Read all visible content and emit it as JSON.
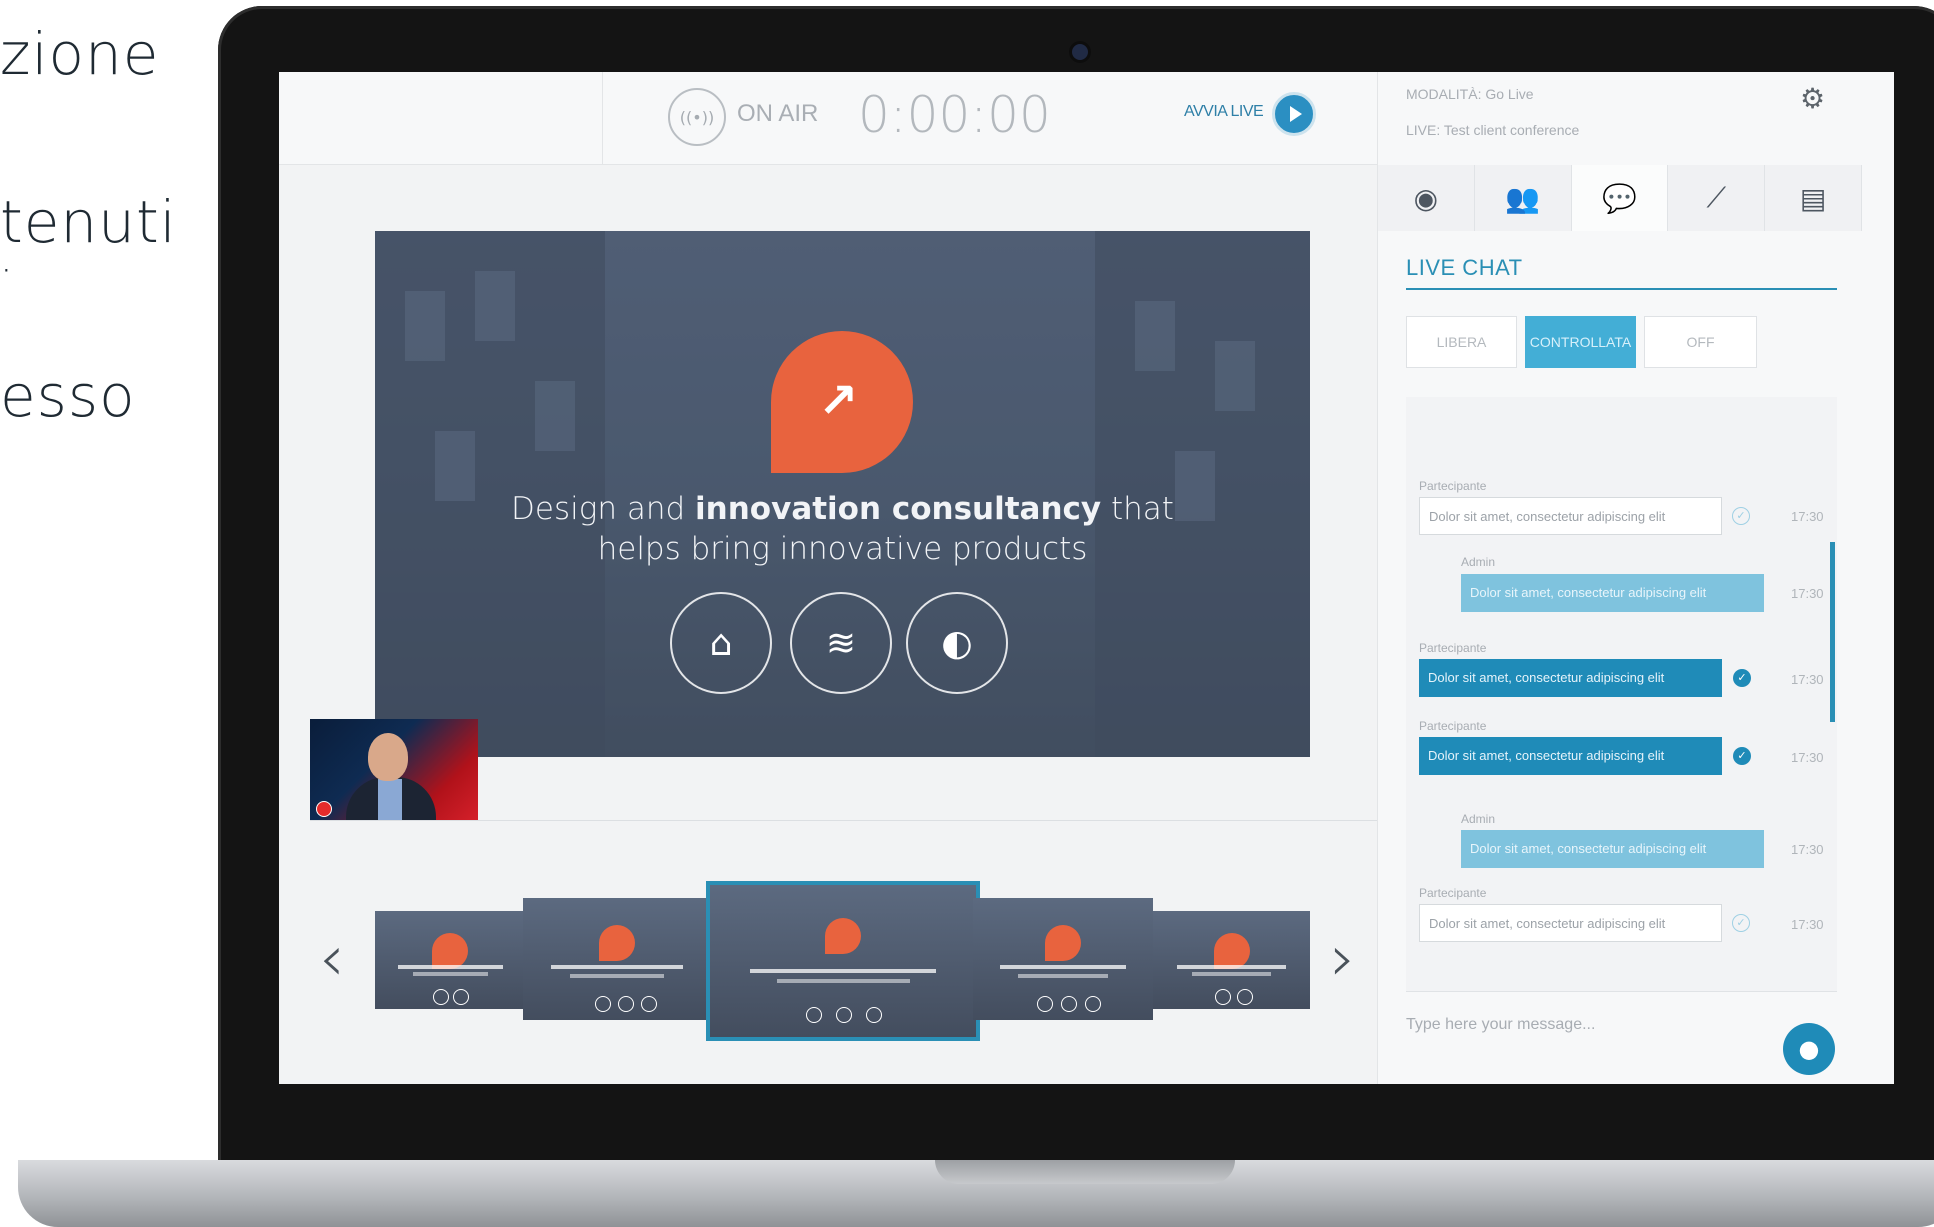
{
  "side_texts": [
    "zione",
    "tenuti",
    "esso"
  ],
  "topbar": {
    "onair_icon": "((•))",
    "onair_label": "ON AIR",
    "timer": "0:00:00",
    "start_label": "AVVIA LIVE"
  },
  "slide": {
    "title_pre": "Design and ",
    "title_bold": "innovation consultancy",
    "title_post": " that",
    "title_line2": "helps bring innovative products",
    "badge_icon": "chart-growth-icon",
    "buttons": [
      "tag-icon",
      "wifi-icon",
      "contrast-icon"
    ]
  },
  "carousel": {
    "prev": "‹",
    "next": "›"
  },
  "panel": {
    "mode_label": "MODALITÀ: Go Live",
    "live_label": "LIVE: Test client conference",
    "chat_title": "LIVE CHAT",
    "chat_modes": [
      "LIBERA",
      "CONTROLLATA",
      "OFF"
    ],
    "active_mode": "CONTROLLATA",
    "input_placeholder": "Type here your message...",
    "messages": [
      {
        "author": "Partecipante",
        "text": "Dolor sit amet, consectetur adipiscing elit",
        "time": "17:30",
        "style": "out",
        "checked": false
      },
      {
        "author": "Admin",
        "text": "Dolor sit amet, consectetur adipiscing elit",
        "time": "17:30",
        "style": "light",
        "checked": false
      },
      {
        "author": "Partecipante",
        "text": "Dolor sit amet, consectetur adipiscing elit",
        "time": "17:30",
        "style": "blue",
        "checked": true
      },
      {
        "author": "Partecipante",
        "text": "Dolor sit amet, consectetur adipiscing elit",
        "time": "17:30",
        "style": "blue",
        "checked": true
      },
      {
        "author": "Admin",
        "text": "Dolor sit amet, consectetur adipiscing elit",
        "time": "17:30",
        "style": "light",
        "checked": false
      },
      {
        "author": "Partecipante",
        "text": "Dolor sit amet, consectetur adipiscing elit",
        "time": "17:30",
        "style": "out",
        "checked": false
      }
    ]
  },
  "colors": {
    "accent": "#2a8fb5",
    "brand_orange": "#e8633e"
  }
}
